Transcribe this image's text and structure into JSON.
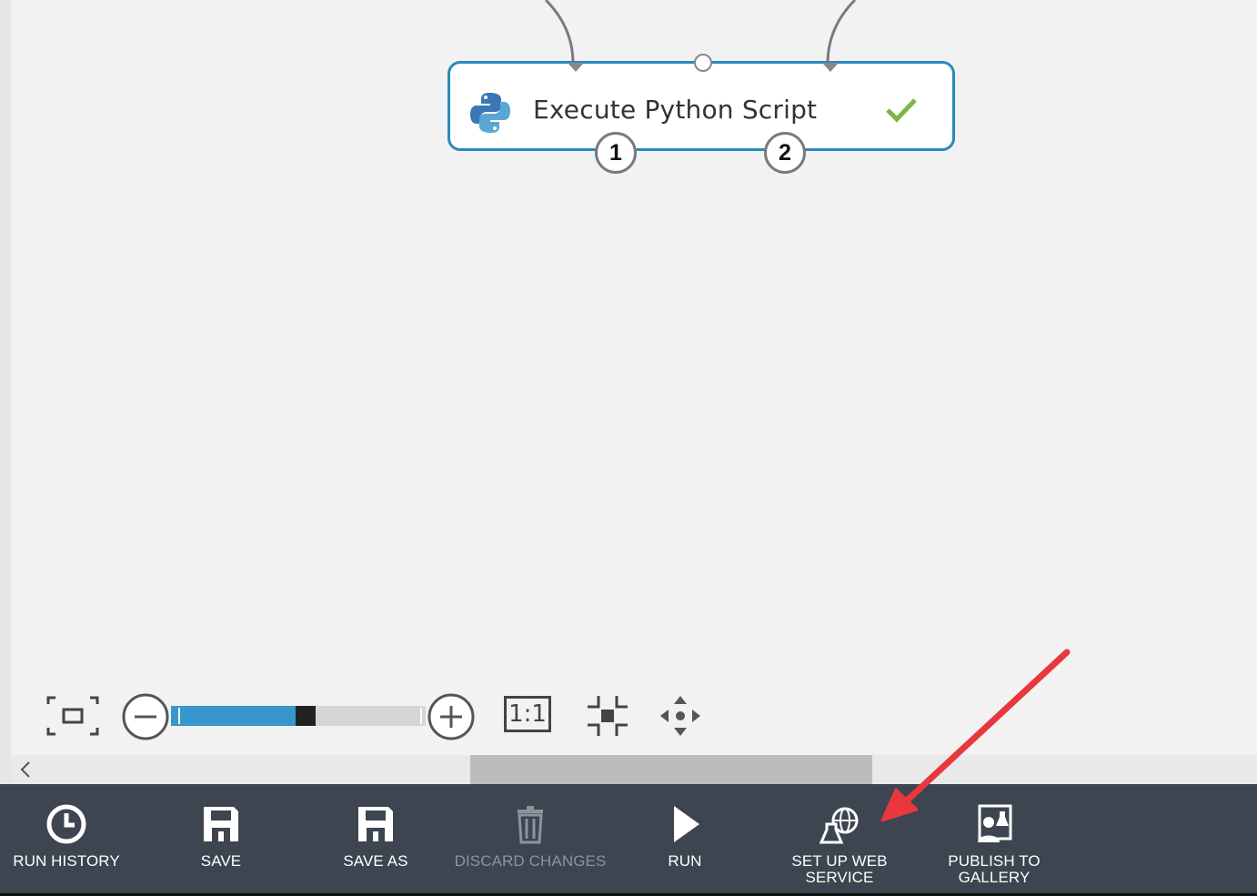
{
  "module": {
    "title": "Execute Python Script",
    "status": "success",
    "output_ports": [
      "1",
      "2"
    ]
  },
  "zoom": {
    "level_fraction": 0.53
  },
  "toolbar": {
    "buttons": [
      {
        "label": "RUN HISTORY",
        "icon": "clock-icon",
        "enabled": true
      },
      {
        "label": "SAVE",
        "icon": "floppy-disk-icon",
        "enabled": true
      },
      {
        "label": "SAVE AS",
        "icon": "floppy-disk-icon",
        "enabled": true
      },
      {
        "label": "DISCARD CHANGES",
        "icon": "trash-icon",
        "enabled": false
      },
      {
        "label": "RUN",
        "icon": "play-icon",
        "enabled": true
      },
      {
        "label": "SET UP WEB\nSERVICE",
        "icon": "web-service-icon",
        "enabled": true
      },
      {
        "label": "PUBLISH TO\nGALLERY",
        "icon": "gallery-icon",
        "enabled": true
      }
    ]
  },
  "colors": {
    "accent": "#2b88c0",
    "check": "#7ab648",
    "toolbar_bg": "#3c4550",
    "annotation_arrow": "#e8383d"
  },
  "zoom_tools": {
    "one_to_one_label": "1:1"
  }
}
